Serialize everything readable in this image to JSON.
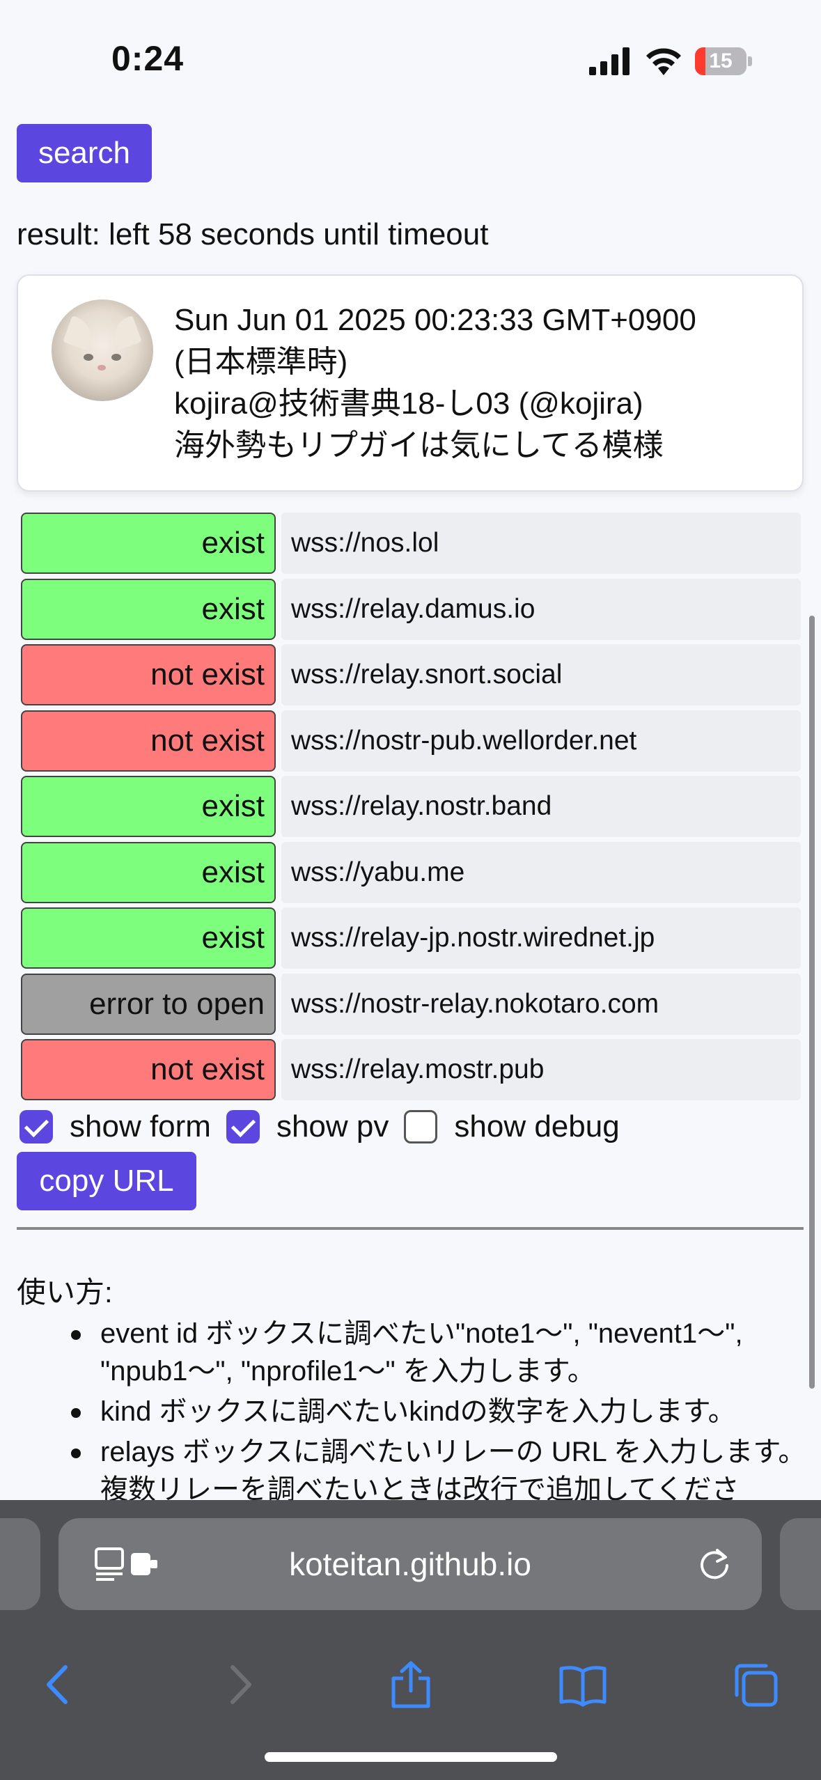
{
  "status_bar": {
    "time": "0:24",
    "battery": "15",
    "battery_fraction": 0.15
  },
  "search_button": "search",
  "result_text": "result: left 58 seconds until timeout",
  "event_card": {
    "line1": "Sun Jun 01 2025 00:23:33 GMT+0900",
    "line2": "(日本標準時)",
    "line3": "kojira@技術書典18-し03 (@kojira)",
    "line4": "海外勢もリプガイは気にしてる模様"
  },
  "relays": [
    {
      "status": "exist",
      "url": "wss://nos.lol",
      "color": "#7dff7d"
    },
    {
      "status": "exist",
      "url": "wss://relay.damus.io",
      "color": "#7dff7d"
    },
    {
      "status": "not exist",
      "url": "wss://relay.snort.social",
      "color": "#ff7a7a"
    },
    {
      "status": "not exist",
      "url": "wss://nostr-pub.wellorder.net",
      "color": "#ff7a7a"
    },
    {
      "status": "exist",
      "url": "wss://relay.nostr.band",
      "color": "#7dff7d"
    },
    {
      "status": "exist",
      "url": "wss://yabu.me",
      "color": "#7dff7d"
    },
    {
      "status": "exist",
      "url": "wss://relay-jp.nostr.wirednet.jp",
      "color": "#7dff7d"
    },
    {
      "status": "error to open",
      "url": "wss://nostr-relay.nokotaro.com",
      "color": "#a0a0a0"
    },
    {
      "status": "not exist",
      "url": "wss://relay.mostr.pub",
      "color": "#ff7a7a"
    }
  ],
  "checkboxes": [
    {
      "label": "show form",
      "checked": true
    },
    {
      "label": "show pv",
      "checked": true
    },
    {
      "label": "show debug",
      "checked": false
    }
  ],
  "copy_button": "copy URL",
  "howto": {
    "title": "使い方:",
    "items": [
      "event id ボックスに調べたい\"note1～\", \"nevent1～\", \"npub1～\", \"nprofile1～\" を入力します。",
      "kind ボックスに調べたいkindの数字を入力します。",
      "relays ボックスに調べたいリレーの URL を入力します。複数リレーを調べたいときは改行で追加してくださ"
    ]
  },
  "browser": {
    "url": "koteitan.github.io"
  },
  "colors": {
    "accent": "#5b47e0",
    "safari_blue": "#3d8bff"
  }
}
